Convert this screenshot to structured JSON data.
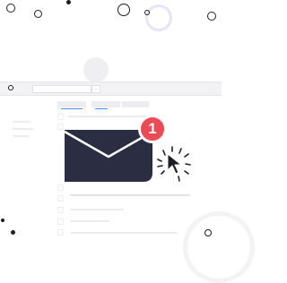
{
  "notification": {
    "count": "1"
  },
  "colors": {
    "envelope": "#2b2d42",
    "badge": "#ec4a55",
    "ring_accent": "#e6e5f7",
    "tab_accent": "#4e8ef7",
    "ink": "#1d1d26"
  },
  "icons": {
    "mail": "envelope-icon",
    "cursor": "pointer-cursor-icon",
    "click": "click-burst-icon"
  }
}
